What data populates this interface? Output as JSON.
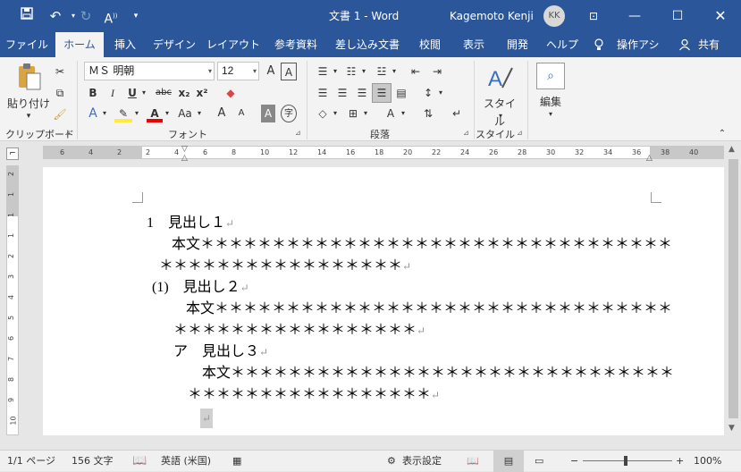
{
  "titlebar": {
    "save_icon": "save-icon",
    "undo_icon": "undo-icon",
    "redo_icon": "redo-icon",
    "readaloud_icon": "read-aloud-icon",
    "customize_icon": "customize-icon",
    "doc_title": "文書 1 - Word",
    "user_name": "Kagemoto Kenji",
    "avatar_initials": "KK"
  },
  "tabs": [
    {
      "label": "ファイル"
    },
    {
      "label": "ホーム"
    },
    {
      "label": "挿入"
    },
    {
      "label": "デザイン"
    },
    {
      "label": "レイアウト"
    },
    {
      "label": "参考資料"
    },
    {
      "label": "差し込み文書"
    },
    {
      "label": "校閲"
    },
    {
      "label": "表示"
    },
    {
      "label": "開発"
    },
    {
      "label": "ヘルプ"
    },
    {
      "label": "操作アシスト"
    },
    {
      "label": "共有"
    }
  ],
  "ribbon": {
    "clipboard": {
      "label": "クリップボード",
      "paste": "貼り付け"
    },
    "font": {
      "label": "フォント",
      "name": "ＭＳ 明朝",
      "size": "12",
      "bold": "B",
      "italic": "I",
      "underline": "U",
      "strike": "abc",
      "subscript": "x₂",
      "superscript": "x²",
      "aa": "Aa",
      "grow": "A",
      "shrink": "A"
    },
    "paragraph": {
      "label": "段落"
    },
    "styles": {
      "label": "スタイル",
      "button": "スタイル"
    },
    "editing": {
      "button": "編集"
    }
  },
  "ruler": {
    "h_ticks": [
      "6",
      "4",
      "2",
      "2",
      "4",
      "6",
      "8",
      "10",
      "12",
      "14",
      "16",
      "18",
      "20",
      "22",
      "24",
      "26",
      "28",
      "30",
      "32",
      "34",
      "36",
      "38",
      "40"
    ],
    "v_ticks": [
      "2",
      "1",
      "1",
      "1",
      "2",
      "3",
      "4",
      "5",
      "6",
      "7",
      "8",
      "9",
      "10"
    ]
  },
  "document": {
    "lines": [
      {
        "text": "1　見出し１"
      },
      {
        "text": "本文＊＊＊＊＊＊＊＊＊＊＊＊＊＊＊＊＊＊＊＊＊＊＊＊＊＊＊＊＊＊＊＊＊"
      },
      {
        "text": "＊＊＊＊＊＊＊＊＊＊＊＊＊＊＊＊＊"
      },
      {
        "text": "(1)　見出し２"
      },
      {
        "text": "本文＊＊＊＊＊＊＊＊＊＊＊＊＊＊＊＊＊＊＊＊＊＊＊＊＊＊＊＊＊＊＊＊"
      },
      {
        "text": "＊＊＊＊＊＊＊＊＊＊＊＊＊＊＊＊＊"
      },
      {
        "text": "ア　見出し３"
      },
      {
        "text": "本文＊＊＊＊＊＊＊＊＊＊＊＊＊＊＊＊＊＊＊＊＊＊＊＊＊＊＊＊＊＊＊"
      },
      {
        "text": "＊＊＊＊＊＊＊＊＊＊＊＊＊＊＊＊＊"
      }
    ],
    "paragraph_mark": "↵"
  },
  "statusbar": {
    "page": "1/1 ページ",
    "words": "156 文字",
    "language": "英語 (米国)",
    "display_settings": "表示設定",
    "zoom_minus": "−",
    "zoom_plus": "+",
    "zoom": "100%",
    "zoom_level": 1.0
  }
}
